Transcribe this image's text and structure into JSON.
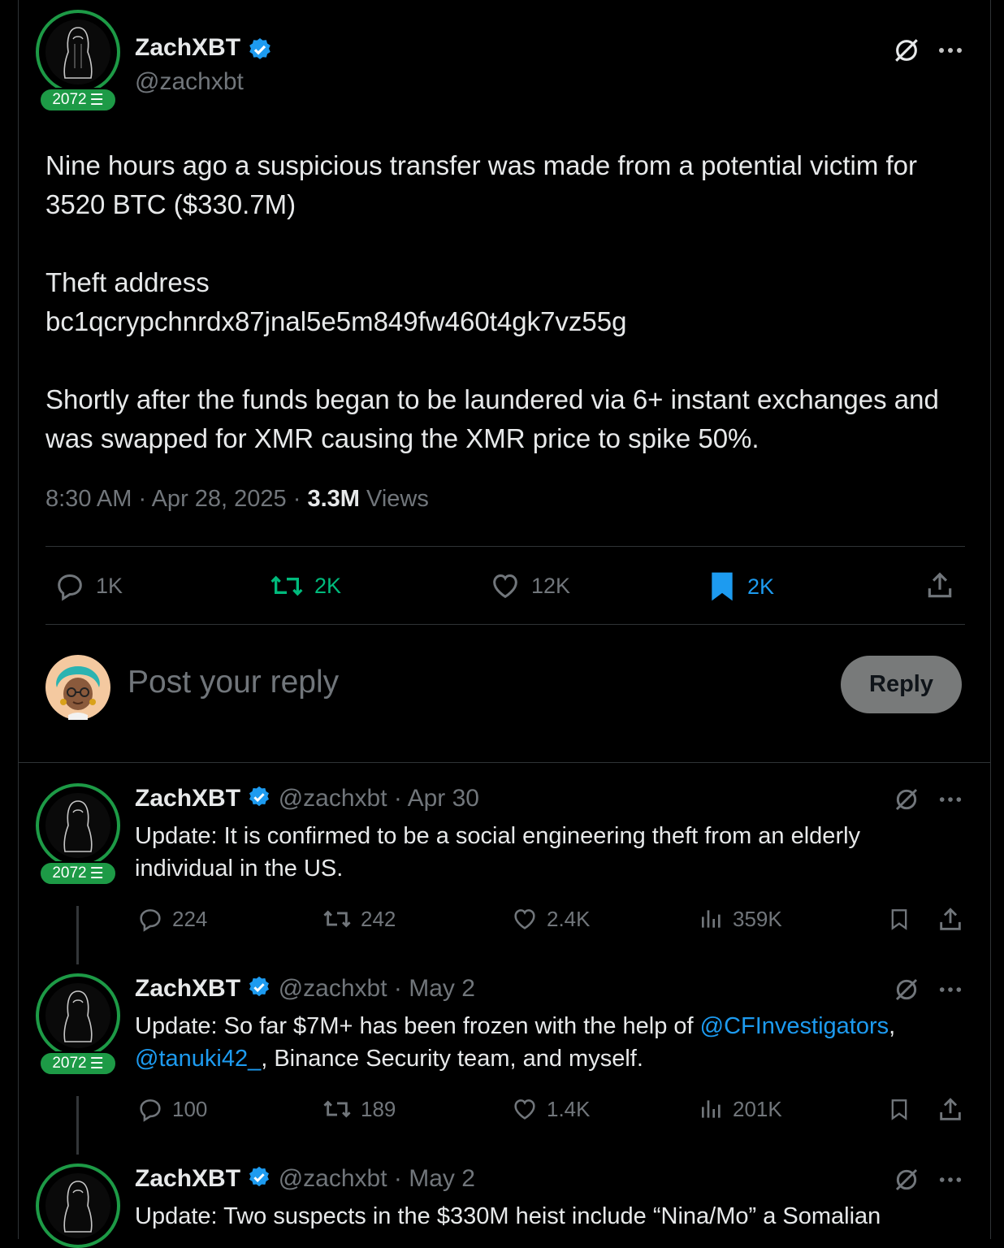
{
  "colors": {
    "accent_blue": "#1d9bf0",
    "retweet_green": "#00ba7c",
    "badge_green": "#1d9a46",
    "muted": "#71767b"
  },
  "main_tweet": {
    "name": "ZachXBT",
    "handle": "@zachxbt",
    "badge": "2072",
    "paragraphs": [
      "Nine hours ago a suspicious transfer was made from a potential victim for 3520 BTC ($330.7M)",
      "Theft address",
      "bc1qcrypchnrdx87jnal5e5m849fw460t4gk7vz55g",
      "Shortly after the funds began to be laundered via 6+ instant exchanges and was swapped for XMR causing the XMR price to spike 50%."
    ],
    "time": "8:30 AM",
    "date": "Apr 28, 2025",
    "views_count": "3.3M",
    "views_label": "Views",
    "actions": {
      "replies": "1K",
      "retweets": "2K",
      "likes": "12K",
      "bookmarks": "2K"
    },
    "icons": [
      "grok-icon",
      "more-icon",
      "reply-icon",
      "retweet-icon",
      "like-icon",
      "bookmark-filled-icon",
      "share-icon"
    ]
  },
  "composer": {
    "placeholder": "Post your reply",
    "button": "Reply"
  },
  "replies": [
    {
      "name": "ZachXBT",
      "handle": "@zachxbt",
      "sep": "·",
      "date": "Apr 30",
      "badge": "2072",
      "text": "Update: It is confirmed to be a social engineering theft from an elderly individual in the US.",
      "stats": {
        "replies": "224",
        "retweets": "242",
        "likes": "2.4K",
        "views": "359K"
      }
    },
    {
      "name": "ZachXBT",
      "handle": "@zachxbt",
      "sep": "·",
      "date": "May 2",
      "badge": "2072",
      "text_pre": "Update: So far $7M+ has been frozen with the help of ",
      "mention1": "@CFInvestigators",
      "text_mid": ", ",
      "mention2": "@tanuki42_",
      "text_post": ", Binance Security team, and myself.",
      "stats": {
        "replies": "100",
        "retweets": "189",
        "likes": "1.4K",
        "views": "201K"
      }
    },
    {
      "name": "ZachXBT",
      "handle": "@zachxbt",
      "sep": "·",
      "date": "May 2",
      "text": "Update: Two suspects in the $330M heist include “Nina/Mo” a Somalian"
    }
  ]
}
